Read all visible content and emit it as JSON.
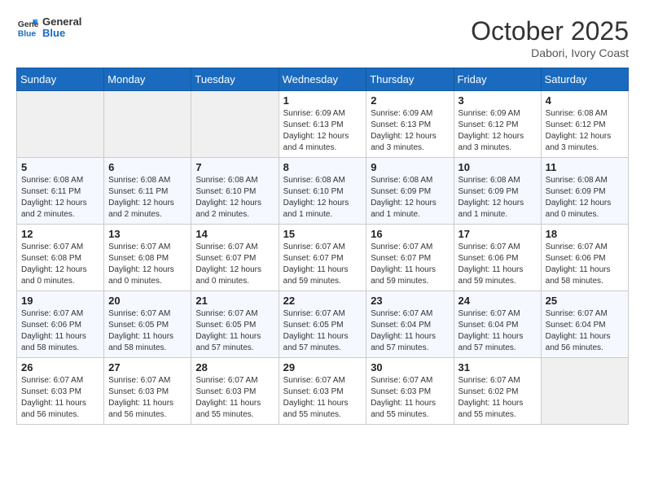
{
  "header": {
    "logo_line1": "General",
    "logo_line2": "Blue",
    "month": "October 2025",
    "location": "Dabori, Ivory Coast"
  },
  "weekdays": [
    "Sunday",
    "Monday",
    "Tuesday",
    "Wednesday",
    "Thursday",
    "Friday",
    "Saturday"
  ],
  "weeks": [
    [
      {
        "day": "",
        "content": ""
      },
      {
        "day": "",
        "content": ""
      },
      {
        "day": "",
        "content": ""
      },
      {
        "day": "1",
        "content": "Sunrise: 6:09 AM\nSunset: 6:13 PM\nDaylight: 12 hours\nand 4 minutes."
      },
      {
        "day": "2",
        "content": "Sunrise: 6:09 AM\nSunset: 6:13 PM\nDaylight: 12 hours\nand 3 minutes."
      },
      {
        "day": "3",
        "content": "Sunrise: 6:09 AM\nSunset: 6:12 PM\nDaylight: 12 hours\nand 3 minutes."
      },
      {
        "day": "4",
        "content": "Sunrise: 6:08 AM\nSunset: 6:12 PM\nDaylight: 12 hours\nand 3 minutes."
      }
    ],
    [
      {
        "day": "5",
        "content": "Sunrise: 6:08 AM\nSunset: 6:11 PM\nDaylight: 12 hours\nand 2 minutes."
      },
      {
        "day": "6",
        "content": "Sunrise: 6:08 AM\nSunset: 6:11 PM\nDaylight: 12 hours\nand 2 minutes."
      },
      {
        "day": "7",
        "content": "Sunrise: 6:08 AM\nSunset: 6:10 PM\nDaylight: 12 hours\nand 2 minutes."
      },
      {
        "day": "8",
        "content": "Sunrise: 6:08 AM\nSunset: 6:10 PM\nDaylight: 12 hours\nand 1 minute."
      },
      {
        "day": "9",
        "content": "Sunrise: 6:08 AM\nSunset: 6:09 PM\nDaylight: 12 hours\nand 1 minute."
      },
      {
        "day": "10",
        "content": "Sunrise: 6:08 AM\nSunset: 6:09 PM\nDaylight: 12 hours\nand 1 minute."
      },
      {
        "day": "11",
        "content": "Sunrise: 6:08 AM\nSunset: 6:09 PM\nDaylight: 12 hours\nand 0 minutes."
      }
    ],
    [
      {
        "day": "12",
        "content": "Sunrise: 6:07 AM\nSunset: 6:08 PM\nDaylight: 12 hours\nand 0 minutes."
      },
      {
        "day": "13",
        "content": "Sunrise: 6:07 AM\nSunset: 6:08 PM\nDaylight: 12 hours\nand 0 minutes."
      },
      {
        "day": "14",
        "content": "Sunrise: 6:07 AM\nSunset: 6:07 PM\nDaylight: 12 hours\nand 0 minutes."
      },
      {
        "day": "15",
        "content": "Sunrise: 6:07 AM\nSunset: 6:07 PM\nDaylight: 11 hours\nand 59 minutes."
      },
      {
        "day": "16",
        "content": "Sunrise: 6:07 AM\nSunset: 6:07 PM\nDaylight: 11 hours\nand 59 minutes."
      },
      {
        "day": "17",
        "content": "Sunrise: 6:07 AM\nSunset: 6:06 PM\nDaylight: 11 hours\nand 59 minutes."
      },
      {
        "day": "18",
        "content": "Sunrise: 6:07 AM\nSunset: 6:06 PM\nDaylight: 11 hours\nand 58 minutes."
      }
    ],
    [
      {
        "day": "19",
        "content": "Sunrise: 6:07 AM\nSunset: 6:06 PM\nDaylight: 11 hours\nand 58 minutes."
      },
      {
        "day": "20",
        "content": "Sunrise: 6:07 AM\nSunset: 6:05 PM\nDaylight: 11 hours\nand 58 minutes."
      },
      {
        "day": "21",
        "content": "Sunrise: 6:07 AM\nSunset: 6:05 PM\nDaylight: 11 hours\nand 57 minutes."
      },
      {
        "day": "22",
        "content": "Sunrise: 6:07 AM\nSunset: 6:05 PM\nDaylight: 11 hours\nand 57 minutes."
      },
      {
        "day": "23",
        "content": "Sunrise: 6:07 AM\nSunset: 6:04 PM\nDaylight: 11 hours\nand 57 minutes."
      },
      {
        "day": "24",
        "content": "Sunrise: 6:07 AM\nSunset: 6:04 PM\nDaylight: 11 hours\nand 57 minutes."
      },
      {
        "day": "25",
        "content": "Sunrise: 6:07 AM\nSunset: 6:04 PM\nDaylight: 11 hours\nand 56 minutes."
      }
    ],
    [
      {
        "day": "26",
        "content": "Sunrise: 6:07 AM\nSunset: 6:03 PM\nDaylight: 11 hours\nand 56 minutes."
      },
      {
        "day": "27",
        "content": "Sunrise: 6:07 AM\nSunset: 6:03 PM\nDaylight: 11 hours\nand 56 minutes."
      },
      {
        "day": "28",
        "content": "Sunrise: 6:07 AM\nSunset: 6:03 PM\nDaylight: 11 hours\nand 55 minutes."
      },
      {
        "day": "29",
        "content": "Sunrise: 6:07 AM\nSunset: 6:03 PM\nDaylight: 11 hours\nand 55 minutes."
      },
      {
        "day": "30",
        "content": "Sunrise: 6:07 AM\nSunset: 6:03 PM\nDaylight: 11 hours\nand 55 minutes."
      },
      {
        "day": "31",
        "content": "Sunrise: 6:07 AM\nSunset: 6:02 PM\nDaylight: 11 hours\nand 55 minutes."
      },
      {
        "day": "",
        "content": ""
      }
    ]
  ]
}
